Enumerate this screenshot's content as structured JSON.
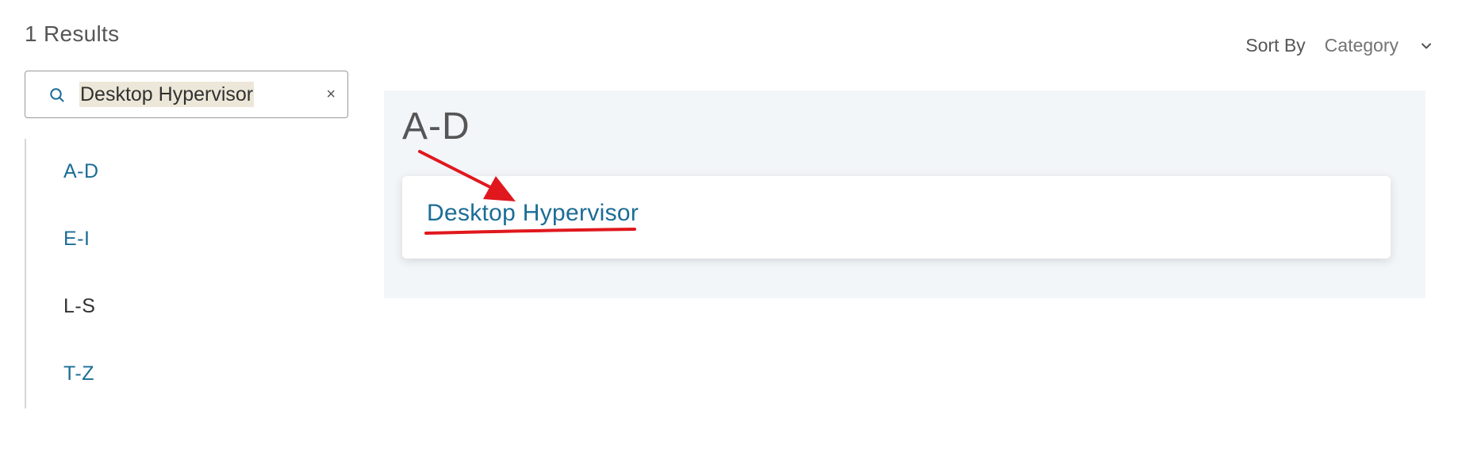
{
  "results": {
    "count_label": "1 Results"
  },
  "sort": {
    "label": "Sort By",
    "value": "Category"
  },
  "search": {
    "value": "Desktop Hypervisor",
    "clear_symbol": "×"
  },
  "nav": {
    "items": [
      {
        "label": "A-D",
        "style": "link"
      },
      {
        "label": "E-I",
        "style": "link"
      },
      {
        "label": "L-S",
        "style": "plain"
      },
      {
        "label": "T-Z",
        "style": "link"
      }
    ]
  },
  "group": {
    "heading": "A-D",
    "results": [
      {
        "title": "Desktop Hypervisor"
      }
    ]
  },
  "colors": {
    "accent_link": "#1b6d95",
    "annotation_red": "#e0181e",
    "panel_background": "#f3f6f9",
    "search_highlight": "#ece7d8"
  },
  "icons": {
    "search": "search-icon",
    "clear": "close-icon",
    "sort_chevron": "chevron-down-icon",
    "annotation_arrow": "arrow-icon"
  }
}
